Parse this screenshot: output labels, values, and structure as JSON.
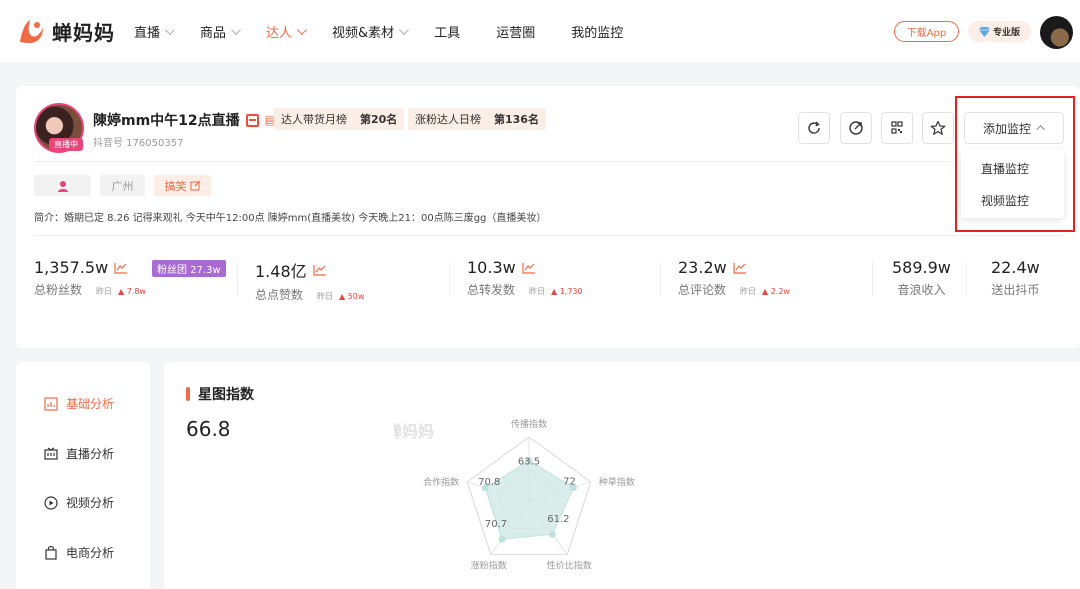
{
  "logo_text": "蝉妈妈",
  "nav": [
    {
      "label": "直播",
      "dropdown": true,
      "active": false
    },
    {
      "label": "商品",
      "dropdown": true,
      "active": false
    },
    {
      "label": "达人",
      "dropdown": true,
      "active": true
    },
    {
      "label": "视频&素材",
      "dropdown": true,
      "active": false
    },
    {
      "label": "工具",
      "dropdown": false,
      "active": false
    },
    {
      "label": "运营圈",
      "dropdown": false,
      "active": false
    },
    {
      "label": "我的监控",
      "dropdown": false,
      "active": false
    }
  ],
  "header": {
    "download": "下载App",
    "pro": "专业版"
  },
  "profile": {
    "name": "陳婷mm中午12点直播",
    "live_badge": "直播中",
    "douyin_id": "抖音号 176050357",
    "ranks": [
      {
        "label": "达人带货月榜",
        "value": "第20名"
      },
      {
        "label": "涨粉达人日榜",
        "value": "第136名"
      }
    ],
    "location": "广州",
    "category": "搞笑",
    "bio": "简介：婚期已定 8.26 记得来观礼 今天中午12:00点 陳婷mm(直播美妆) 今天晚上21：00点陈三废gg（直播美妆）",
    "add_monitor": "添加监控",
    "dropdown": [
      "直播监控",
      "视频监控"
    ]
  },
  "stats": [
    {
      "value": "1,357.5w",
      "label": "总粉丝数",
      "yesterday": "昨日",
      "delta": "▲ 7.8w",
      "trend": true
    },
    {
      "value": "1.48亿",
      "label": "总点赞数",
      "yesterday": "昨日",
      "delta": "▲ 50w",
      "trend": true
    },
    {
      "value": "10.3w",
      "label": "总转发数",
      "yesterday": "昨日",
      "delta": "▲ 1,730",
      "trend": true
    },
    {
      "value": "23.2w",
      "label": "总评论数",
      "yesterday": "昨日",
      "delta": "▲ 2.2w",
      "trend": true
    },
    {
      "value": "589.9w",
      "label": "音浪收入"
    },
    {
      "value": "22.4w",
      "label": "送出抖币"
    }
  ],
  "fans_badge": "粉丝团 27.3w",
  "sidebar": [
    {
      "label": "基础分析",
      "active": true
    },
    {
      "label": "直播分析",
      "active": false
    },
    {
      "label": "视频分析",
      "active": false
    },
    {
      "label": "电商分析",
      "active": false
    }
  ],
  "star_index": {
    "title": "星图指数",
    "score": "66.8",
    "watermark": "蝉妈妈",
    "axes": [
      "传播指数",
      "种草指数",
      "性价比指数",
      "涨粉指数",
      "合作指数"
    ],
    "values": [
      63.5,
      72,
      61.2,
      70.7,
      70.8
    ],
    "value_labels": [
      "63.5",
      "72",
      "61.2",
      "70.7",
      "70.8"
    ]
  },
  "colors": {
    "accent": "#ef6a45",
    "highlight_box": "#e0231e",
    "radar_fill": "#cfe9e5",
    "fans_badge": "#a86bd1"
  }
}
